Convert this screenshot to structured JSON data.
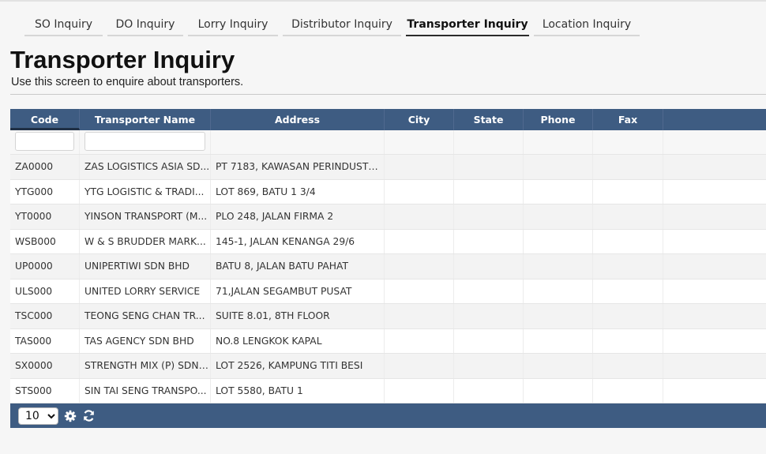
{
  "tabs": [
    {
      "label": "SO Inquiry",
      "active": false
    },
    {
      "label": "DO Inquiry",
      "active": false
    },
    {
      "label": "Lorry Inquiry",
      "active": false
    },
    {
      "label": "Distributor Inquiry",
      "active": false
    },
    {
      "label": "Transporter Inquiry",
      "active": true
    },
    {
      "label": "Location Inquiry",
      "active": false
    }
  ],
  "page": {
    "title": "Transporter Inquiry",
    "subtitle": "Use this screen to enquire about transporters."
  },
  "grid": {
    "columns": [
      "Code",
      "Transporter Name",
      "Address",
      "City",
      "State",
      "Phone",
      "Fax"
    ],
    "sorted_column": "Code",
    "rows": [
      {
        "code": "ZA0000",
        "name": "ZAS LOGISTICS ASIA SD...",
        "address": "PT 7183, KAWASAN PERINDUSTRI...",
        "city": "",
        "state": "",
        "phone": "",
        "fax": ""
      },
      {
        "code": "YTG000",
        "name": "YTG LOGISTIC & TRADI...",
        "address": "LOT 869, BATU 1 3/4",
        "city": "",
        "state": "",
        "phone": "",
        "fax": ""
      },
      {
        "code": "YT0000",
        "name": "YINSON TRANSPORT (M...",
        "address": "PLO 248, JALAN FIRMA 2",
        "city": "",
        "state": "",
        "phone": "",
        "fax": ""
      },
      {
        "code": "WSB000",
        "name": "W & S BRUDDER MARK...",
        "address": "145-1, JALAN KENANGA 29/6",
        "city": "",
        "state": "",
        "phone": "",
        "fax": ""
      },
      {
        "code": "UP0000",
        "name": "UNIPERTIWI SDN BHD",
        "address": "BATU 8, JALAN BATU PAHAT",
        "city": "",
        "state": "",
        "phone": "",
        "fax": ""
      },
      {
        "code": "ULS000",
        "name": "UNITED LORRY SERVICE",
        "address": "71,JALAN SEGAMBUT PUSAT",
        "city": "",
        "state": "",
        "phone": "",
        "fax": ""
      },
      {
        "code": "TSC000",
        "name": "TEONG SENG CHAN TR...",
        "address": "SUITE 8.01, 8TH FLOOR",
        "city": "",
        "state": "",
        "phone": "",
        "fax": ""
      },
      {
        "code": "TAS000",
        "name": "TAS AGENCY SDN BHD",
        "address": "NO.8 LENGKOK KAPAL",
        "city": "",
        "state": "",
        "phone": "",
        "fax": ""
      },
      {
        "code": "SX0000",
        "name": "STRENGTH MIX (P) SDN ...",
        "address": "LOT 2526, KAMPUNG TITI BESI",
        "city": "",
        "state": "",
        "phone": "",
        "fax": ""
      },
      {
        "code": "STS000",
        "name": "SIN TAI SENG TRANSPO...",
        "address": "LOT 5580, BATU 1",
        "city": "",
        "state": "",
        "phone": "",
        "fax": ""
      }
    ]
  },
  "pager": {
    "page_size": "10",
    "icons": [
      "gear-icon",
      "refresh-icon"
    ]
  },
  "colors": {
    "header_bg": "#3e5c82",
    "page_bg": "#f6f6f6"
  }
}
